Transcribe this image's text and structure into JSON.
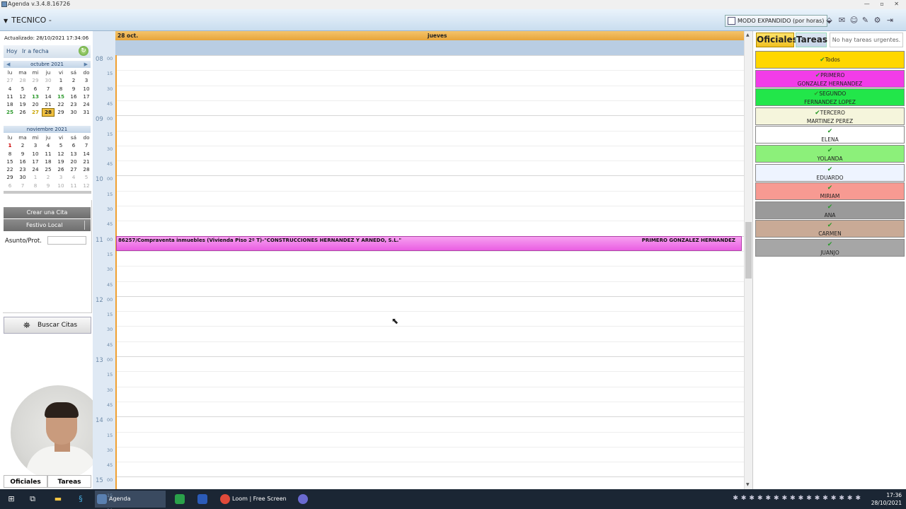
{
  "window": {
    "title": "Agenda  v.3.4.8.16726"
  },
  "toolbar": {
    "tecnico": "TECNICO -",
    "modo": "MODO EXPANDIDO (por horas)"
  },
  "left": {
    "updated": "Actualizado: 28/10/2021 17:34:06",
    "hoy": "Hoy",
    "ir_fecha": "Ir a fecha",
    "oct": {
      "title": "octubre 2021",
      "days_header": [
        "lu",
        "ma",
        "mi",
        "ju",
        "vi",
        "sá",
        "do"
      ],
      "rows": [
        [
          "27",
          "28",
          "29",
          "30",
          "1",
          "2",
          "3"
        ],
        [
          "4",
          "5",
          "6",
          "7",
          "8",
          "9",
          "10"
        ],
        [
          "11",
          "12",
          "13",
          "14",
          "15",
          "16",
          "17"
        ],
        [
          "18",
          "19",
          "20",
          "21",
          "22",
          "23",
          "24"
        ],
        [
          "25",
          "26",
          "27",
          "28",
          "29",
          "30",
          "31"
        ]
      ]
    },
    "nov": {
      "title": "noviembre 2021",
      "days_header": [
        "lu",
        "ma",
        "mi",
        "ju",
        "vi",
        "sá",
        "do"
      ],
      "rows": [
        [
          "1",
          "2",
          "3",
          "4",
          "5",
          "6",
          "7"
        ],
        [
          "8",
          "9",
          "10",
          "11",
          "12",
          "13",
          "14"
        ],
        [
          "15",
          "16",
          "17",
          "18",
          "19",
          "20",
          "21"
        ],
        [
          "22",
          "23",
          "24",
          "25",
          "26",
          "27",
          "28"
        ],
        [
          "29",
          "30",
          "1",
          "2",
          "3",
          "4",
          "5"
        ],
        [
          "6",
          "7",
          "8",
          "9",
          "10",
          "11",
          "12"
        ]
      ]
    },
    "crear_cita": "Crear una Cita",
    "festivo": "Festivo Local",
    "asunto_label": "Asunto/Prot.",
    "asunto_value": "",
    "buscar": "Buscar Citas",
    "tab_oficiales": "Oficiales",
    "tab_tareas": "Tareas"
  },
  "schedule": {
    "date": "28 oct.",
    "weekday": "jueves",
    "hours": [
      "08",
      "09",
      "10",
      "11",
      "12",
      "13",
      "14",
      "15"
    ],
    "minutes": [
      "00",
      "15",
      "30",
      "45"
    ],
    "appointment": {
      "subject": "86257/Compraventa inmuebles (Vivienda Piso 2º T)-\"CONSTRUCCIONES HERNANDEZ Y ARNEDO, S.L.\"",
      "officer": "PRIMERO GONZALEZ HERNANDEZ",
      "start_hour": "11",
      "start_minute": "00",
      "color": "#ee6ee6"
    }
  },
  "right": {
    "tab_oficiales": "Oficiales",
    "tab_tareas": "Tareas",
    "urgentes": "No hay tareas urgentes.",
    "officers": [
      {
        "line1": "Todos",
        "line2": "",
        "color": "#ffd700"
      },
      {
        "line1": "PRIMERO",
        "line2": "GONZALEZ HERNANDEZ",
        "color": "#f23ce8"
      },
      {
        "line1": "SEGUNDO",
        "line2": "FERNANDEZ LOPEZ",
        "color": "#22e64a"
      },
      {
        "line1": "TERCERO",
        "line2": "MARTINEZ PEREZ",
        "color": "#f5f5dc"
      },
      {
        "line1": "",
        "line2": "ELENA",
        "color": "#ffffff"
      },
      {
        "line1": "",
        "line2": "YOLANDA",
        "color": "#8cf07a"
      },
      {
        "line1": "",
        "line2": "EDUARDO",
        "color": "#eef4ff"
      },
      {
        "line1": "",
        "line2": "MIRIAM",
        "color": "#f79a92"
      },
      {
        "line1": "",
        "line2": "ANA",
        "color": "#9a9a9a"
      },
      {
        "line1": "",
        "line2": "CARMEN",
        "color": "#c9aa96"
      },
      {
        "line1": "",
        "line2": "JUANJO",
        "color": "#a6a6a6"
      }
    ]
  },
  "taskbar": {
    "apps": [
      {
        "label": "Agenda  v.3.4.8.167...",
        "color": "#5a80b0"
      },
      {
        "label": "",
        "color": "#2aa14a"
      },
      {
        "label": "",
        "color": "#2b5bb8"
      },
      {
        "label": "Loom | Free Screen ...",
        "color": "#e04a3a"
      },
      {
        "label": "",
        "color": "#6a6ad0"
      }
    ],
    "time": "17:36",
    "date": "28/10/2021"
  }
}
